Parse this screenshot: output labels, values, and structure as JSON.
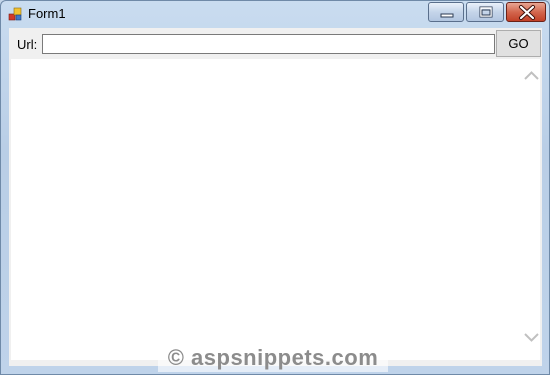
{
  "window": {
    "title": "Form1",
    "controls": [
      "minimize-icon",
      "maximize-icon",
      "close-icon"
    ]
  },
  "toolbar": {
    "url_label": "Url:",
    "url_value": "",
    "go_label": "GO"
  },
  "browser": {
    "scrollbar_icons": [
      "chevron-up-icon",
      "chevron-down-icon"
    ]
  },
  "watermark": "© aspsnippets.com"
}
